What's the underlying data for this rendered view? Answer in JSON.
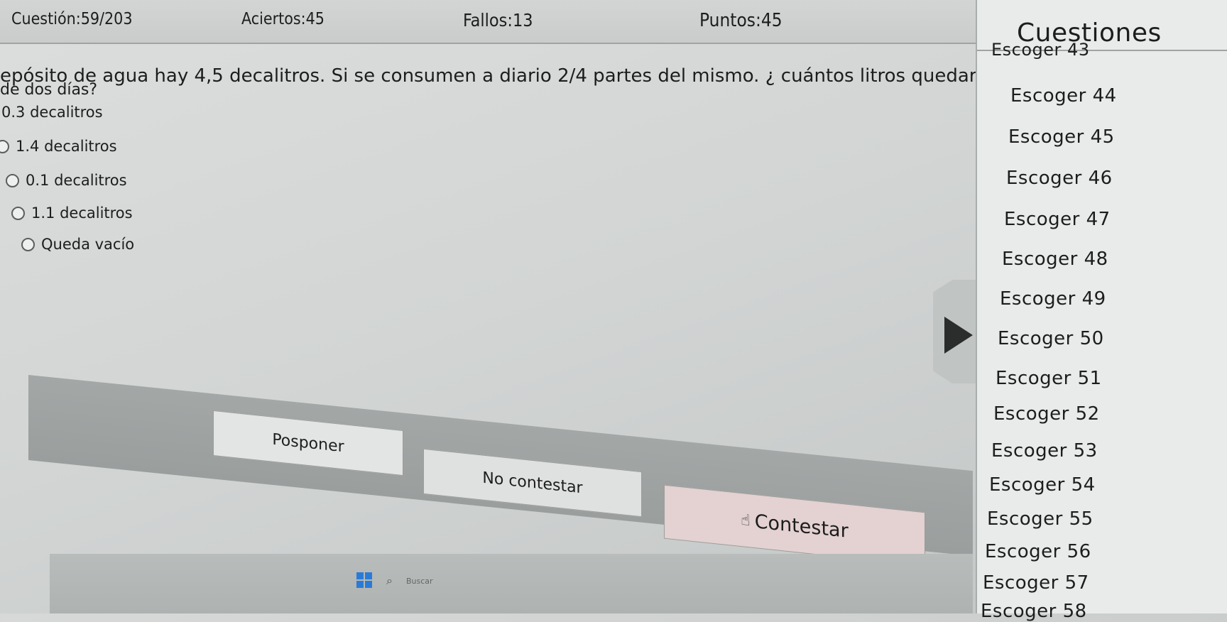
{
  "stats": {
    "cuestion": "Cuestión:59/203",
    "aciertos": "Aciertos:45",
    "fallos": "Fallos:13",
    "puntos": "Puntos:45"
  },
  "question": {
    "line1": "epósito de agua hay 4,5 decalitros. Si se consumen a diario 2/4 partes del mismo. ¿ cuántos litros quedarán",
    "line2": "de dos días?"
  },
  "options": [
    {
      "label": "0.3 decalitros"
    },
    {
      "label": "1.4 decalitros"
    },
    {
      "label": "0.1 decalitros"
    },
    {
      "label": "1.1 decalitros"
    },
    {
      "label": "Queda vacío"
    }
  ],
  "buttons": {
    "posponer": "Posponer",
    "no_contestar": "No contestar",
    "contestar": "Contestar"
  },
  "sidebar": {
    "title": "Cuestiones",
    "items": [
      "Escoger 43",
      "Escoger 44",
      "Escoger 45",
      "Escoger 46",
      "Escoger 47",
      "Escoger 48",
      "Escoger 49",
      "Escoger 50",
      "Escoger 51",
      "Escoger 52",
      "Escoger 53",
      "Escoger 54",
      "Escoger 55",
      "Escoger 56",
      "Escoger 57",
      "Escoger 58"
    ]
  },
  "taskbar": {
    "search_label": "Buscar",
    "icons": [
      "windows-start-icon",
      "search-icon"
    ]
  },
  "colors": {
    "contestar_bg": "#e4d1d1",
    "panel_bg": "#d2d5d4",
    "sidebar_bg": "#e8ebea"
  }
}
